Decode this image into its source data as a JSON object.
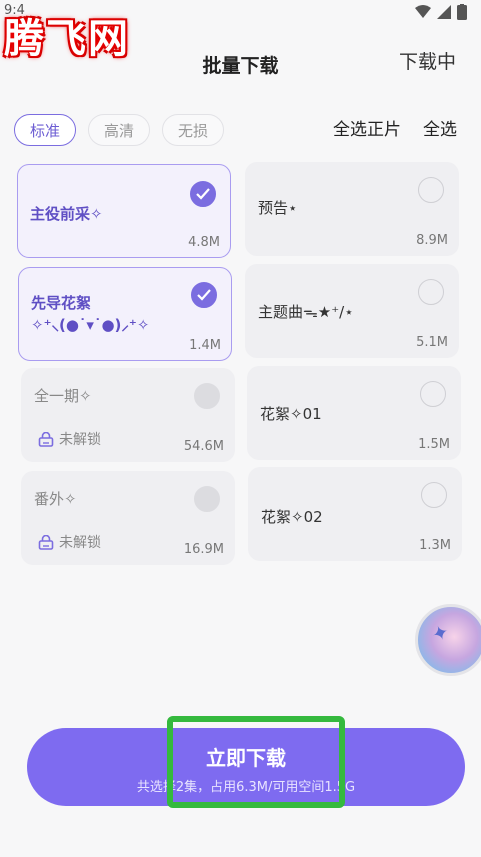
{
  "status_bar": {
    "time": "9:4"
  },
  "watermark": "腾飞网",
  "header": {
    "title": "批量下载",
    "action": "下载中"
  },
  "quality_tabs": [
    {
      "label": "标准",
      "active": true
    },
    {
      "label": "高清",
      "active": false
    },
    {
      "label": "无损",
      "active": false
    }
  ],
  "select_links": {
    "select_episodes": "全选正片",
    "select_all": "全选"
  },
  "cards": [
    {
      "title": "主役前采✧",
      "size": "4.8M",
      "state": "checked"
    },
    {
      "title": "预告⋆",
      "size": "8.9M",
      "state": "unchecked"
    },
    {
      "title": "先导花絮\n✧⁺⸜(●˙▾˙●)⸝⁺✧",
      "size": "1.4M",
      "state": "checked"
    },
    {
      "title": "主题曲ᯓ★⁺/⋆",
      "size": "5.1M",
      "state": "unchecked"
    },
    {
      "title": "全一期✧",
      "size": "54.6M",
      "state": "locked",
      "lock_label": "未解锁"
    },
    {
      "title": "花絮✧01",
      "size": "1.5M",
      "state": "unchecked"
    },
    {
      "title": "番外✧",
      "size": "16.9M",
      "state": "locked",
      "lock_label": "未解锁"
    },
    {
      "title": "花絮✧02",
      "size": "1.3M",
      "state": "unchecked"
    }
  ],
  "download": {
    "label": "立即下载",
    "info": "共选择2集，占用6.3M/可用空间1.5G"
  },
  "colors": {
    "accent": "#7e6bf0",
    "highlight": "#35b93e"
  }
}
